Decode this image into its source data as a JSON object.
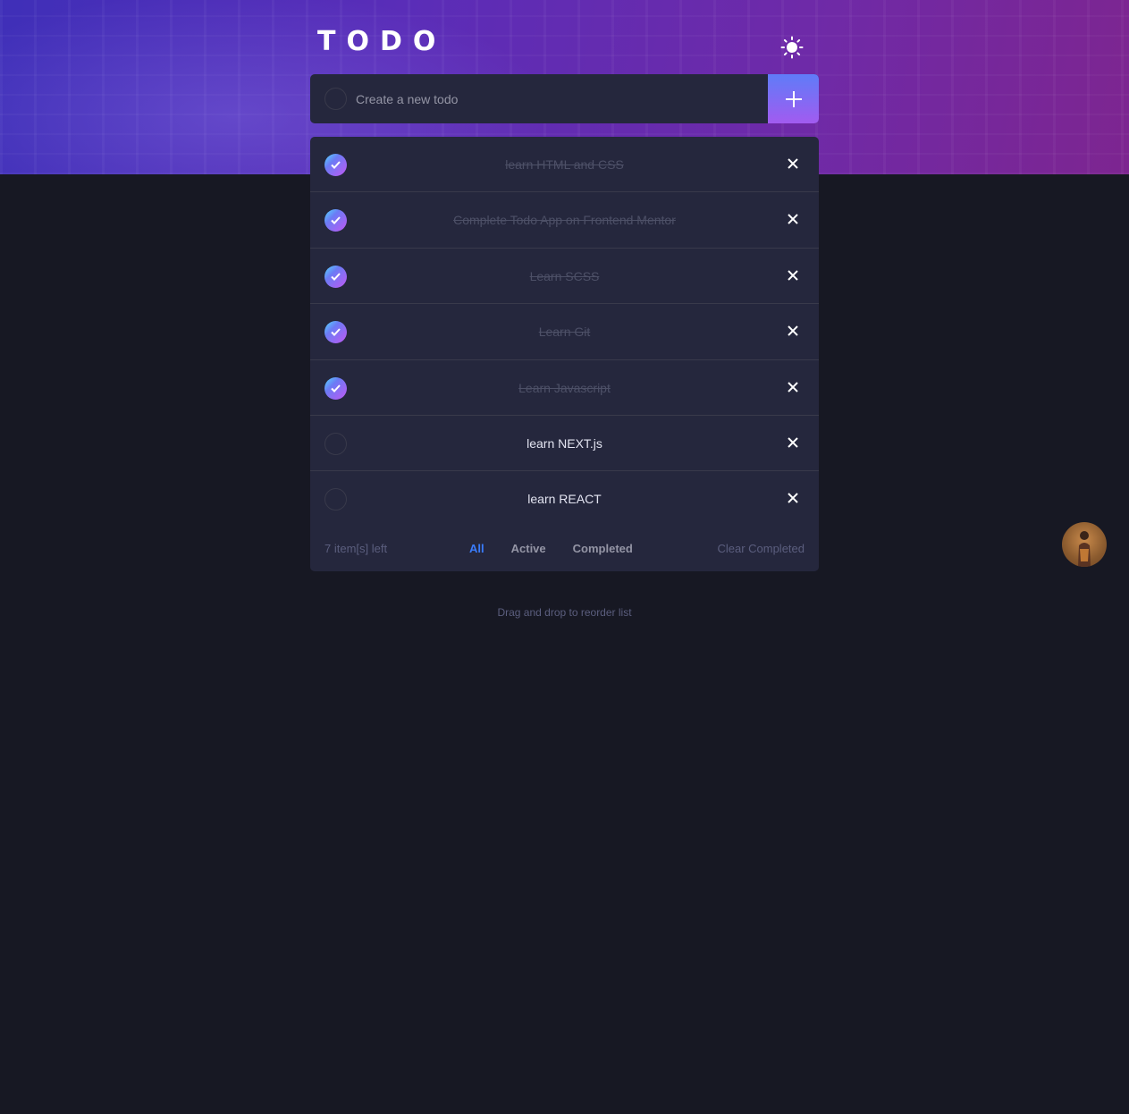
{
  "header": {
    "title": "TODO",
    "theme_icon": "sun-icon"
  },
  "new_todo": {
    "placeholder": "Create a new todo",
    "value": "",
    "add_icon": "plus-icon"
  },
  "todos": [
    {
      "text": "learn HTML and CSS",
      "completed": true
    },
    {
      "text": "Complete Todo App on Frontend Mentor",
      "completed": true
    },
    {
      "text": "Learn SCSS",
      "completed": true
    },
    {
      "text": "Learn Git",
      "completed": true
    },
    {
      "text": "Learn Javascript",
      "completed": true
    },
    {
      "text": "learn NEXT.js",
      "completed": false
    },
    {
      "text": "learn REACT",
      "completed": false
    }
  ],
  "footer": {
    "items_left": "7 item[s] left",
    "filters": [
      "All",
      "Active",
      "Completed"
    ],
    "active_filter": "All",
    "clear_label": "Clear Completed"
  },
  "hint": "Drag and drop to reorder list",
  "colors": {
    "background": "#171823",
    "card": "#25273d",
    "accent_blue": "#3a7cfd",
    "check_gradient_start": "#55ddff",
    "check_gradient_end": "#c058f3"
  }
}
